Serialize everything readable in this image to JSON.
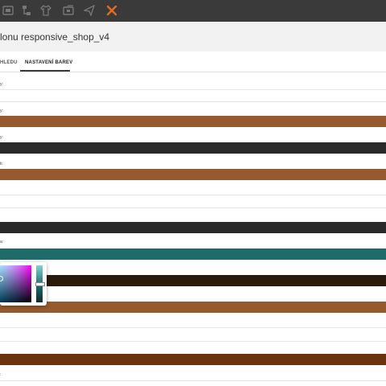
{
  "toolbar": {
    "icons": [
      "sitemap-icon",
      "hierarchy-icon",
      "shirt-icon",
      "image-folder-icon",
      "send-icon",
      "tools-icon"
    ],
    "accent": "#e36c1e"
  },
  "header": {
    "title": "lonu responsive_shop_v4"
  },
  "tabs": [
    {
      "label": "HLEDU"
    },
    {
      "label": "NASTAVENÍ BAREV",
      "active": true
    }
  ],
  "rows": [
    {
      "label": "y:",
      "color": ""
    },
    {
      "label": "y:",
      "color": "#955a2e"
    },
    {
      "label": "y:",
      "color": "#2a2a2a"
    },
    {
      "label": "ti:",
      "color": "#955a2e"
    },
    {
      "label": "",
      "color": ""
    },
    {
      "label": "",
      "color": "#2a2a2a"
    },
    {
      "label": "a:",
      "color": "#1f6b6b"
    },
    {
      "label": "",
      "color": "#2a1a0c"
    },
    {
      "label": "",
      "color": "#955a2e"
    },
    {
      "label": "",
      "color": ""
    },
    {
      "label": "",
      "color": "#6b320e"
    },
    {
      "label": ":",
      "color": ""
    }
  ],
  "picker": {
    "hue_color": "#1f6b6b"
  }
}
